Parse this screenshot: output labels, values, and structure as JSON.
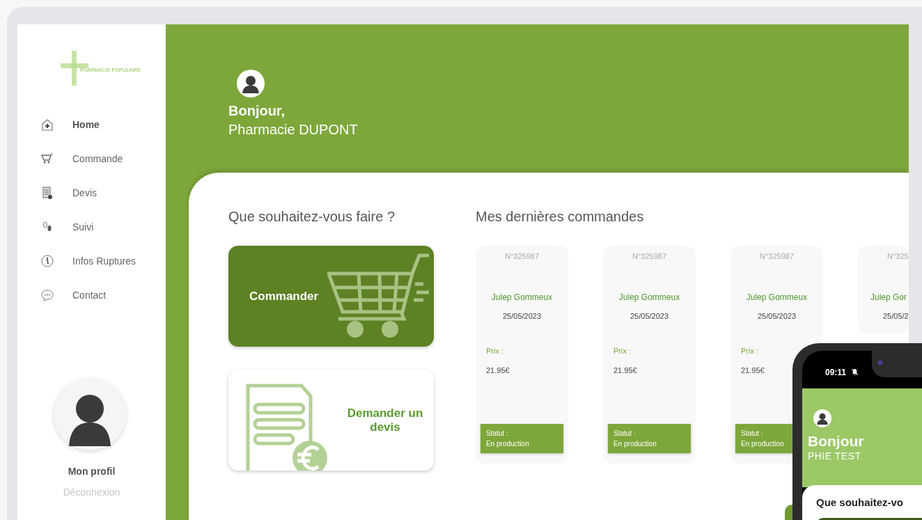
{
  "logo": {
    "text": "PHARMACIE POPULAIRE"
  },
  "sidebar": {
    "items": [
      {
        "label": "Home",
        "selected": true
      },
      {
        "label": "Commande",
        "selected": false
      },
      {
        "label": "Devis",
        "selected": false
      },
      {
        "label": "Suivi",
        "selected": false
      },
      {
        "label": "Infos Ruptures",
        "selected": false
      },
      {
        "label": "Contact",
        "selected": false
      }
    ],
    "profile": {
      "label": "Mon profil",
      "logout": "Déconnexion"
    }
  },
  "header": {
    "greeting": "Bonjour,",
    "name": "Pharmacie DUPONT"
  },
  "actions": {
    "title": "Que souhaitez-vous faire ?",
    "items": [
      {
        "kind": "order",
        "label": "Commander"
      },
      {
        "kind": "quote",
        "label": "Demander un devis"
      }
    ]
  },
  "orders": {
    "title": "Mes dernières commandes",
    "items": [
      {
        "number": "N°325987",
        "product": "Julep Gommeux",
        "date": "25/05/2023",
        "price_label": "Prix :",
        "price": "21.95€",
        "status_label": "Statut :",
        "status": "En production"
      },
      {
        "number": "N°325987",
        "product": "Julep Gommeux",
        "date": "25/05/2023",
        "price_label": "Prix :",
        "price": "21.95€",
        "status_label": "Statut :",
        "status": "En production"
      },
      {
        "number": "N°325987",
        "product": "Julep Gommeux",
        "date": "25/05/2023",
        "price_label": "Prix :",
        "price": "21.95€",
        "status_label": "Statut :",
        "status": "En production"
      },
      {
        "number": "N°325",
        "product": "Julep Gor",
        "date": "25/05/2"
      }
    ]
  },
  "phone": {
    "time": "09:11",
    "greeting": "Bonjour",
    "name": "PHIE TEST",
    "title": "Que souhaitez-vo"
  }
}
